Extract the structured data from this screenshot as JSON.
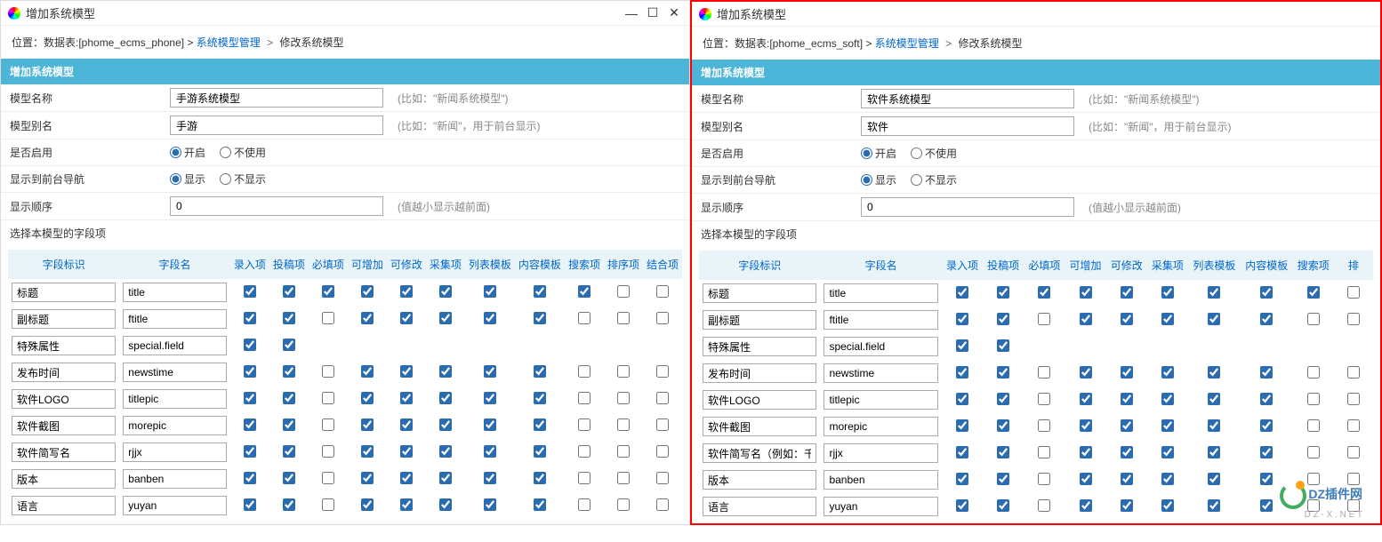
{
  "leftPanel": {
    "windowTitle": "增加系统模型",
    "breadcrumb": {
      "prefix": "位置：数据表:[phome_ecms_phone] > ",
      "link": "系统模型管理",
      "sep": " > ",
      "tail": "修改系统模型"
    },
    "sectionHeader": "增加系统模型",
    "form": {
      "modelNameLabel": "模型名称",
      "modelNameValue": "手游系统模型",
      "modelNameHint": "(比如：\"新闻系统模型\")",
      "aliasLabel": "模型别名",
      "aliasValue": "手游",
      "aliasHint": "(比如：\"新闻\"，用于前台显示)",
      "enableLabel": "是否启用",
      "enableOn": "开启",
      "enableOff": "不使用",
      "navLabel": "显示到前台导航",
      "navOn": "显示",
      "navOff": "不显示",
      "orderLabel": "显示顺序",
      "orderValue": "0",
      "orderHint": "(值越小显示越前面)"
    },
    "fieldSectionLabel": "选择本模型的字段项",
    "columns": [
      "字段标识",
      "字段名",
      "录入项",
      "投稿项",
      "必填项",
      "可增加",
      "可修改",
      "采集项",
      "列表模板",
      "内容模板",
      "搜索项",
      "排序项",
      "结合项"
    ],
    "rows": [
      {
        "id": "标题",
        "name": "title",
        "cb": [
          true,
          true,
          true,
          true,
          true,
          true,
          true,
          true,
          true,
          false,
          false
        ]
      },
      {
        "id": "副标题",
        "name": "ftitle",
        "cb": [
          true,
          true,
          false,
          true,
          true,
          true,
          true,
          true,
          false,
          false,
          false
        ]
      },
      {
        "id": "特殊属性",
        "name": "special.field",
        "cb": [
          true,
          true,
          null,
          null,
          null,
          null,
          null,
          null,
          null,
          null,
          null
        ]
      },
      {
        "id": "发布时间",
        "name": "newstime",
        "cb": [
          true,
          true,
          false,
          true,
          true,
          true,
          true,
          true,
          false,
          false,
          false
        ]
      },
      {
        "id": "软件LOGO",
        "name": "titlepic",
        "cb": [
          true,
          true,
          false,
          true,
          true,
          true,
          true,
          true,
          false,
          false,
          false
        ]
      },
      {
        "id": "软件截图",
        "name": "morepic",
        "cb": [
          true,
          true,
          false,
          true,
          true,
          true,
          true,
          true,
          false,
          false,
          false
        ]
      },
      {
        "id": "软件简写名",
        "name": "rjjx",
        "cb": [
          true,
          true,
          false,
          true,
          true,
          true,
          true,
          true,
          false,
          false,
          false
        ]
      },
      {
        "id": "版本",
        "name": "banben",
        "cb": [
          true,
          true,
          false,
          true,
          true,
          true,
          true,
          true,
          false,
          false,
          false
        ]
      },
      {
        "id": "语言",
        "name": "yuyan",
        "cb": [
          true,
          true,
          false,
          true,
          true,
          true,
          true,
          true,
          false,
          false,
          false
        ]
      }
    ]
  },
  "rightPanel": {
    "windowTitle": "增加系统模型",
    "breadcrumb": {
      "prefix": "位置：数据表:[phome_ecms_soft] > ",
      "link": "系统模型管理",
      "sep": " > ",
      "tail": "修改系统模型"
    },
    "sectionHeader": "增加系统模型",
    "form": {
      "modelNameLabel": "模型名称",
      "modelNameValue": "软件系统模型",
      "modelNameHint": "(比如：\"新闻系统模型\")",
      "aliasLabel": "模型别名",
      "aliasValue": "软件",
      "aliasHint": "(比如：\"新闻\"，用于前台显示)",
      "enableLabel": "是否启用",
      "enableOn": "开启",
      "enableOff": "不使用",
      "navLabel": "显示到前台导航",
      "navOn": "显示",
      "navOff": "不显示",
      "orderLabel": "显示顺序",
      "orderValue": "0",
      "orderHint": "(值越小显示越前面)"
    },
    "fieldSectionLabel": "选择本模型的字段项",
    "columns": [
      "字段标识",
      "字段名",
      "录入项",
      "投稿项",
      "必填项",
      "可增加",
      "可修改",
      "采集项",
      "列表模板",
      "内容模板",
      "搜索项",
      "排"
    ],
    "rows": [
      {
        "id": "标题",
        "name": "title",
        "cb": [
          true,
          true,
          true,
          true,
          true,
          true,
          true,
          true,
          true,
          false
        ]
      },
      {
        "id": "副标题",
        "name": "ftitle",
        "cb": [
          true,
          true,
          false,
          true,
          true,
          true,
          true,
          true,
          false,
          false
        ]
      },
      {
        "id": "特殊属性",
        "name": "special.field",
        "cb": [
          true,
          true,
          null,
          null,
          null,
          null,
          null,
          null,
          null,
          null
        ]
      },
      {
        "id": "发布时间",
        "name": "newstime",
        "cb": [
          true,
          true,
          false,
          true,
          true,
          true,
          true,
          true,
          false,
          false
        ]
      },
      {
        "id": "软件LOGO",
        "name": "titlepic",
        "cb": [
          true,
          true,
          false,
          true,
          true,
          true,
          true,
          true,
          false,
          false
        ]
      },
      {
        "id": "软件截图",
        "name": "morepic",
        "cb": [
          true,
          true,
          false,
          true,
          true,
          true,
          true,
          true,
          false,
          false
        ]
      },
      {
        "id": "软件简写名（例如：千",
        "name": "rjjx",
        "cb": [
          true,
          true,
          false,
          true,
          true,
          true,
          true,
          true,
          false,
          false
        ]
      },
      {
        "id": "版本",
        "name": "banben",
        "cb": [
          true,
          true,
          false,
          true,
          true,
          true,
          true,
          true,
          false,
          false
        ]
      },
      {
        "id": "语言",
        "name": "yuyan",
        "cb": [
          true,
          true,
          false,
          true,
          true,
          true,
          true,
          true,
          false,
          false
        ]
      }
    ]
  },
  "watermark": {
    "text": "DZ插件网",
    "sub": "D Z - X . N E T"
  }
}
